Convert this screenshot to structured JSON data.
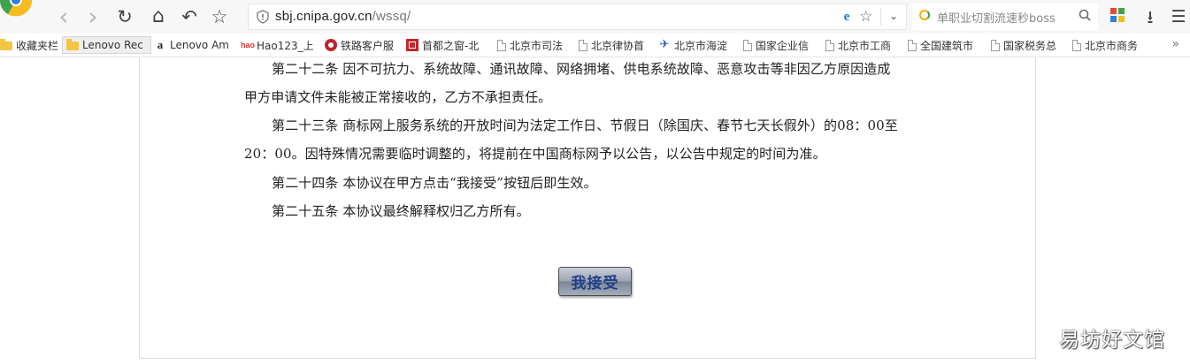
{
  "toolbar": {
    "back_icon": "‹",
    "forward_icon": "›",
    "reload_icon": "↻",
    "home_icon": "⌂",
    "undo_icon": "↶",
    "favorite_icon": "☆",
    "url_host": "sbj.cnipa.gov.cn",
    "url_path": "/wssq/",
    "compat_icon": "e",
    "star_icon": "☆",
    "dropdown_icon": "⌄",
    "search_text": "单职业切割流速秒boss",
    "download_icon": "⭳",
    "menu_icon": "☰",
    "accent": "#1e74d6"
  },
  "bookmarks": [
    {
      "label": "收藏夹栏",
      "icon": "folder-icon"
    },
    {
      "label": "Lenovo Rec",
      "icon": "folder-icon"
    },
    {
      "label": "Lenovo Am",
      "icon": "amazon-icon"
    },
    {
      "label": "Hao123_上",
      "icon": "hao123-icon"
    },
    {
      "label": "铁路客户服",
      "icon": "railway-icon"
    },
    {
      "label": "首都之窗-北",
      "icon": "capital-icon"
    },
    {
      "label": "北京市司法",
      "icon": "page-icon"
    },
    {
      "label": "北京律协首",
      "icon": "page-icon"
    },
    {
      "label": "北京市海淀",
      "icon": "haidian-icon"
    },
    {
      "label": "国家企业信",
      "icon": "page-icon"
    },
    {
      "label": "北京市工商",
      "icon": "page-icon"
    },
    {
      "label": "全国建筑市",
      "icon": "page-icon"
    },
    {
      "label": "国家税务总",
      "icon": "page-icon"
    },
    {
      "label": "北京市商务",
      "icon": "page-icon"
    }
  ],
  "bookmarks_more": "»",
  "agreement": {
    "art22_line1": "第二十二条 因不可抗力、系统故障、通讯故障、网络拥堵、供电系统故障、恶意攻击等非因乙方原因造成",
    "art22_line2": "甲方申请文件未能被正常接收的，乙方不承担责任。",
    "art23_line1": "第二十三条 商标网上服务系统的开放时间为法定工作日、节假日（除国庆、春节七天长假外）的08：00至",
    "art23_line2": "20：00。因特殊情况需要临时调整的，将提前在中国商标网予以公告，以公告中规定的时间为准。",
    "art24": "第二十四条 本协议在甲方点击“我接受”按钮后即生效。",
    "art25": "第二十五条 本协议最终解释权归乙方所有。"
  },
  "accept_button_label": "我接受",
  "watermark": "易坊好文馆"
}
